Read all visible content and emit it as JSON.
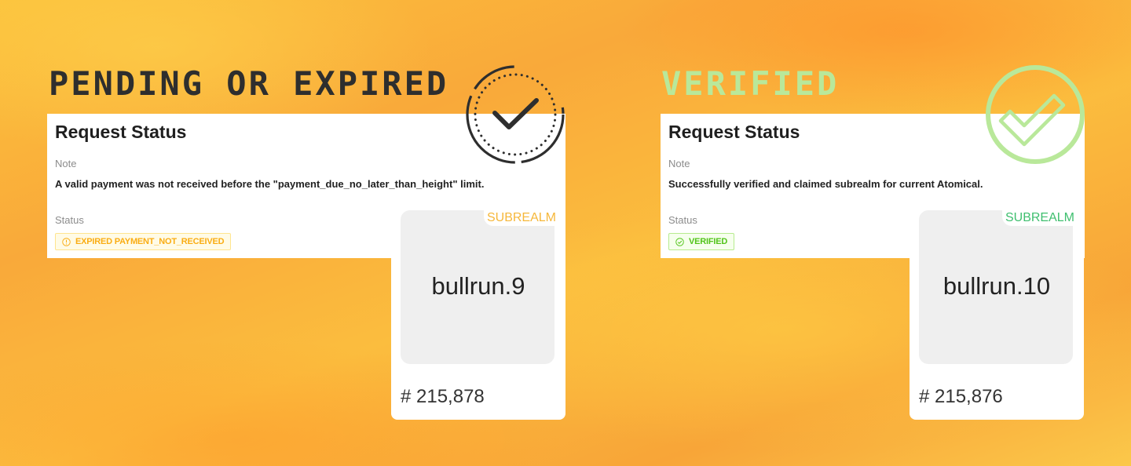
{
  "pending_section": {
    "heading": "PENDING OR EXPIRED",
    "card_title": "Request Status",
    "note_label": "Note",
    "note_text": "A valid payment was not received before the \"payment_due_no_later_than_height\" limit.",
    "status_label": "Status",
    "status_badge": "EXPIRED PAYMENT_NOT_RECEIVED",
    "badge_icon": "exclamation-circle-icon",
    "badge_color": "#faad14",
    "check_icon": "dotted-circle-check-icon",
    "nft": {
      "type_label": "SUBREALM",
      "name": "bullrun.9",
      "number": "# 215,878"
    }
  },
  "verified_section": {
    "heading": "VERIFIED",
    "card_title": "Request Status",
    "note_label": "Note",
    "note_text": "Successfully verified and claimed subrealm for current Atomical.",
    "status_label": "Status",
    "status_badge": "VERIFIED",
    "badge_icon": "check-circle-icon",
    "badge_color": "#52c41a",
    "check_icon": "circle-check-icon",
    "nft": {
      "type_label": "SUBREALM",
      "name": "bullrun.10",
      "number": "# 215,876"
    }
  },
  "colors": {
    "background": "#f9b13c",
    "pending_heading": "#2e2e2e",
    "verified_heading": "#b9e89a"
  }
}
